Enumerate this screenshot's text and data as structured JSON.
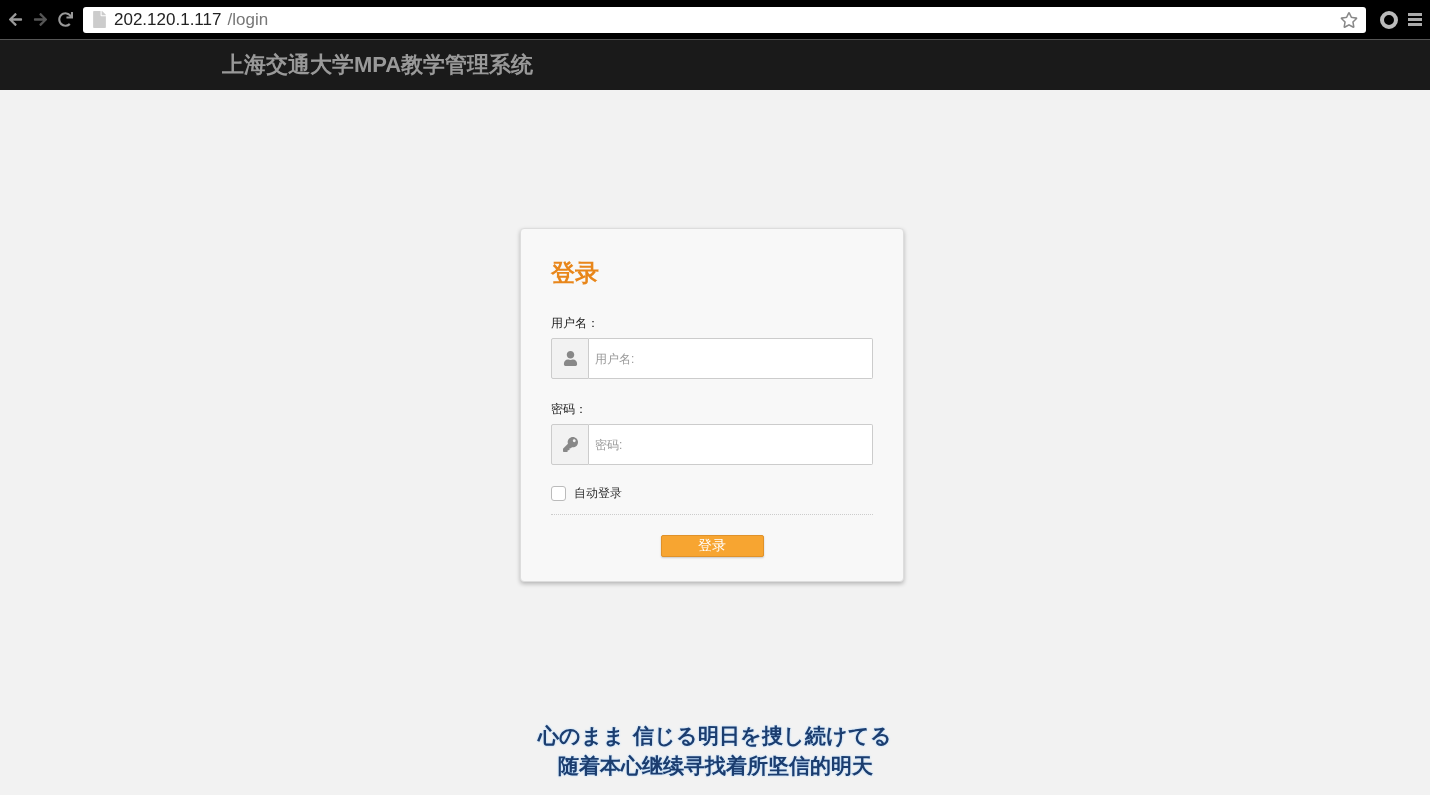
{
  "browser": {
    "url_host": "202.120.1.117",
    "url_path": "/login",
    "bookmarked": false
  },
  "header": {
    "title": "上海交通大学MPA教学管理系统"
  },
  "login": {
    "title": "登录",
    "fields": [
      {
        "kind": "user",
        "label": "用户名：",
        "placeholder": "用户名:"
      },
      {
        "kind": "password",
        "label": "密码：",
        "placeholder": "密码:"
      }
    ],
    "remember": {
      "label": "自动登录",
      "checked": false
    },
    "submit": "登录"
  },
  "lyrics": [
    "心のまま 信じる明日を捜し続けてる",
    "随着本心继续寻找着所坚信的明天"
  ]
}
